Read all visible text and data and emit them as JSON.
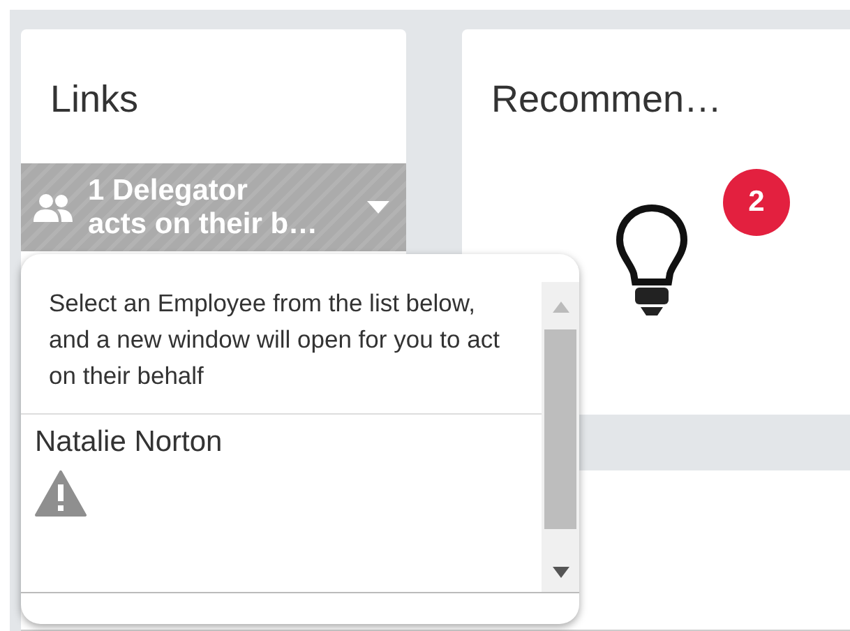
{
  "links_card": {
    "title": "Links",
    "delegator_button": {
      "line_1": "1 Delegator",
      "line_2": "acts on their b…"
    }
  },
  "recommendations_card": {
    "title": "Recommen…",
    "badge": "2"
  },
  "delegate_popup": {
    "instructions": "Select an Employee from the list below, and a new window will open for you to act on their behalf",
    "employees": [
      {
        "name": "Natalie Norton",
        "warning": true
      }
    ]
  }
}
